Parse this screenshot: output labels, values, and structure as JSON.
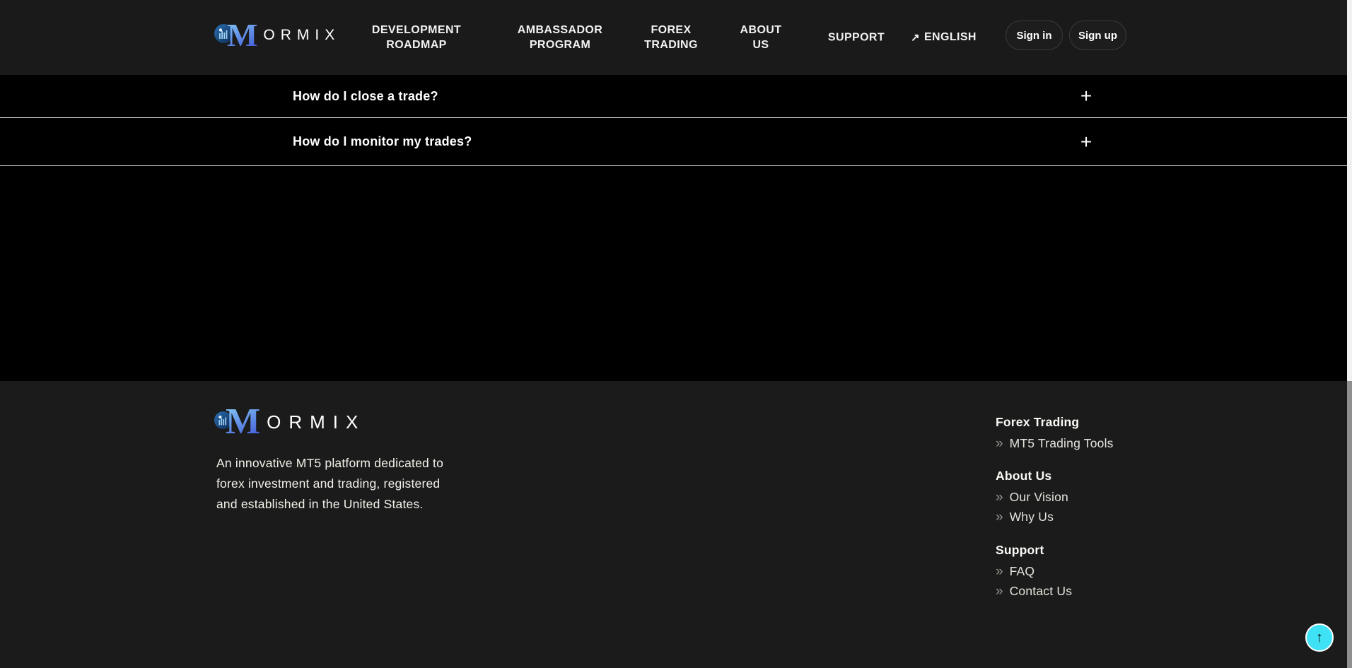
{
  "brand": {
    "icon": "bar-chart-circle-icon",
    "letter": "M",
    "name": "ORMIX"
  },
  "nav": {
    "items": [
      {
        "line1": "DEVELOPMENT",
        "line2": "ROADMAP"
      },
      {
        "line1": "AMBASSADOR",
        "line2": "PROGRAM"
      },
      {
        "line1": "FOREX",
        "line2": "TRADING"
      },
      {
        "line1": "ABOUT",
        "line2": "US"
      },
      {
        "line1": "SUPPORT",
        "line2": ""
      }
    ],
    "language": {
      "icon": "↗",
      "label": "ENGLISH"
    }
  },
  "auth": {
    "sign_in": "Sign in",
    "sign_up": "Sign up"
  },
  "faq": {
    "items": [
      {
        "question": "How do I close a trade?",
        "icon": "+"
      },
      {
        "question": "How do I monitor my trades?",
        "icon": "+"
      }
    ]
  },
  "footer": {
    "description_lines": {
      "line1": "An innovative MT5 platform dedicated to",
      "line2": "forex investment and trading, registered",
      "line3": "and established in the United States."
    },
    "link_icon": "»",
    "columns": [
      {
        "heading": "Forex Trading",
        "links": [
          "MT5 Trading Tools"
        ]
      },
      {
        "heading": "About Us",
        "links": [
          "Our Vision",
          "Why Us"
        ]
      },
      {
        "heading": "Support",
        "links": [
          "FAQ",
          "Contact Us"
        ]
      }
    ]
  },
  "scroll_top": {
    "icon": "↑"
  },
  "colors": {
    "nav_bg": "#1a1a1a",
    "section_bg": "#000000",
    "footer_bg": "#1b1b1b",
    "divider": "#e3e3e3",
    "accent_cyan": "#3fe1f4",
    "logo_gradient_start": "#85c9f4",
    "logo_gradient_end": "#3e55d6"
  }
}
